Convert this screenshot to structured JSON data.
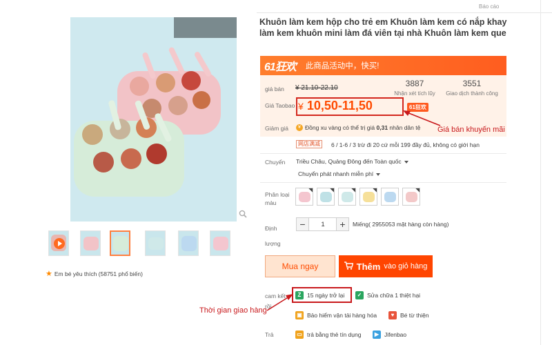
{
  "report_link": "Báo cáo",
  "product": {
    "title": "Khuôn làm kem hộp cho trẻ em Khuôn làm kem có nắp khay làm kem khuôn mini làm đá viên tại nhà Khuôn làm kem que"
  },
  "promo": {
    "logo": "61狂欢",
    "text": "此商品活动中，快买!"
  },
  "pricing": {
    "original_label": "giá bán",
    "original_price": "¥ 21.10-22.10",
    "taobao_label": "Giá Taobao",
    "currency": "¥",
    "price_range": "10,50-11,50",
    "tag": "61狂欢",
    "reviews_count": "3887",
    "reviews_label": "Nhận xét tích lũy",
    "transactions_count": "3551",
    "transactions_label": "Giao dịch thành công"
  },
  "annotations": {
    "promo_price": "Giá bán khuyến mãi",
    "delivery_time": "Thời gian giao hàng"
  },
  "discount": {
    "label": "Giảm giá",
    "coin_text_prefix": "Đồng xu vàng có thể trị giá",
    "coin_value": "0,31",
    "coin_text_suffix": "nhân dân tệ",
    "store_tag": "网店满减",
    "store_offer": "6 / 1-6 / 3 trừ đi 20 cứ mỗi 199 đầy đủ, không có giới hạn"
  },
  "shipping": {
    "label": "Chuyển",
    "route": "Triều Châu, Quảng Đông đến Toàn quốc",
    "method": "Chuyển phát nhanh miễn phí"
  },
  "variants": {
    "label_line1": "Phân loại",
    "label_line2": "màu",
    "swatch_colors": [
      "#f4c6cf",
      "#bfe1e6",
      "#cfe9e9",
      "#f6e09a",
      "#bcd9f0",
      "#f3c9c9"
    ]
  },
  "quantity": {
    "label_line1": "Định",
    "label_line2": "lượng",
    "minus": "−",
    "plus": "+",
    "value": "1",
    "stock_text": "Miếng( 2955053 mặt hàng còn hàng)"
  },
  "actions": {
    "buy_now": "Mua ngay",
    "add_cart_big": "Thêm",
    "add_cart_rest": "vào giỏ hàng"
  },
  "guarantees": {
    "label": "cam kết",
    "label_cont": "rồi",
    "pay_label": "Trả",
    "items": [
      "15 ngày trở lại",
      "Sửa chữa 1 thiệt hại",
      "Bảo hiểm vận tải hàng hóa",
      "Bé từ thiện",
      "trả bằng thẻ tín dụng",
      "Jifenbao"
    ]
  },
  "favorites": "Em bé yêu thích (58751 phổ biến)",
  "colors": {
    "accent": "#ff4500",
    "price": "#ff4a00",
    "annotation": "#c8181b"
  }
}
